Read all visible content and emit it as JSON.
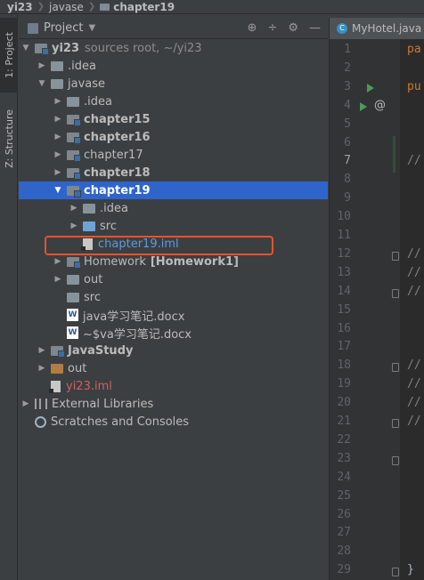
{
  "breadcrumb": {
    "items": [
      "yi23",
      "javase",
      "chapter19"
    ]
  },
  "stripe": {
    "project_tab": "1: Project",
    "structure_tab": "Z: Structure"
  },
  "panel": {
    "title": "Project",
    "tools": [
      "⊕",
      "÷",
      "⚙",
      "—"
    ]
  },
  "tree": [
    {
      "level": 0,
      "arrow": "down",
      "icon": "folder-module",
      "label": "yi23",
      "suffix": "sources root,  ~/yi23",
      "bold": true
    },
    {
      "level": 1,
      "arrow": "right",
      "icon": "folder",
      "label": ".idea"
    },
    {
      "level": 1,
      "arrow": "down",
      "icon": "folder",
      "label": "javase"
    },
    {
      "level": 2,
      "arrow": "right",
      "icon": "folder",
      "label": ".idea"
    },
    {
      "level": 2,
      "arrow": "right",
      "icon": "folder-module",
      "label": "chapter15",
      "bold": true
    },
    {
      "level": 2,
      "arrow": "right",
      "icon": "folder-module",
      "label": "chapter16",
      "bold": true
    },
    {
      "level": 2,
      "arrow": "right",
      "icon": "folder-module",
      "label": "chapter17"
    },
    {
      "level": 2,
      "arrow": "right",
      "icon": "folder-module",
      "label": "chapter18",
      "bold": true
    },
    {
      "level": 2,
      "arrow": "down",
      "icon": "folder-module",
      "label": "chapter19",
      "bold": true,
      "selected": true
    },
    {
      "level": 3,
      "arrow": "right",
      "icon": "folder",
      "label": ".idea"
    },
    {
      "level": 3,
      "arrow": "right",
      "icon": "folder-blue",
      "label": "src"
    },
    {
      "level": 3,
      "arrow": "none",
      "icon": "iml-file",
      "label": "chapter19.iml",
      "color": "blue"
    },
    {
      "level": 2,
      "arrow": "right",
      "icon": "folder-module",
      "label": "Homework",
      "suffix_bold": "[Homework1]"
    },
    {
      "level": 2,
      "arrow": "right",
      "icon": "folder",
      "label": "out"
    },
    {
      "level": 2,
      "arrow": "none",
      "icon": "folder",
      "label": "src"
    },
    {
      "level": 2,
      "arrow": "none",
      "icon": "word-file",
      "label": "java学习笔记.docx"
    },
    {
      "level": 2,
      "arrow": "none",
      "icon": "word-file",
      "label": "~$va学习笔记.docx"
    },
    {
      "level": 1,
      "arrow": "right",
      "icon": "folder-module",
      "label": "JavaStudy",
      "bold": true
    },
    {
      "level": 1,
      "arrow": "right",
      "icon": "folder-brown",
      "label": "out"
    },
    {
      "level": 1,
      "arrow": "none",
      "icon": "iml-file",
      "label": "yi23.iml",
      "color": "red"
    },
    {
      "level": 0,
      "arrow": "right",
      "icon": "libraries",
      "label": "External Libraries"
    },
    {
      "level": 0,
      "arrow": "none",
      "icon": "scratches",
      "label": "Scratches and Consoles"
    }
  ],
  "editor": {
    "tab_label": "MyHotel.java",
    "tab_icon": "C",
    "current_line": 7,
    "line_numbers": [
      "1",
      "2",
      "3",
      "4",
      "5",
      "6",
      "7",
      "8",
      "9",
      "10",
      "11",
      "12",
      "13",
      "14",
      "15",
      "16",
      "17",
      "18",
      "19",
      "20",
      "21",
      "22",
      "23",
      "24",
      "25",
      "26",
      "27",
      "28",
      "29"
    ],
    "code": [
      {
        "line": 1,
        "text": "pa"
      },
      {
        "line": 3,
        "text": "pu"
      },
      {
        "line": 7,
        "text": "//",
        "comment": true
      },
      {
        "line": 12,
        "text": "//",
        "comment": true
      },
      {
        "line": 13,
        "text": "//",
        "comment": true
      },
      {
        "line": 14,
        "text": "//",
        "comment": true
      },
      {
        "line": 18,
        "text": "//",
        "comment": true
      },
      {
        "line": 19,
        "text": "//",
        "comment": true
      },
      {
        "line": 20,
        "text": "//",
        "comment": true
      },
      {
        "line": 21,
        "text": "//",
        "comment": true
      },
      {
        "line": 29,
        "text": "}",
        "plain": true
      }
    ],
    "run_markers": [
      3,
      4
    ],
    "override_marker": "@"
  }
}
